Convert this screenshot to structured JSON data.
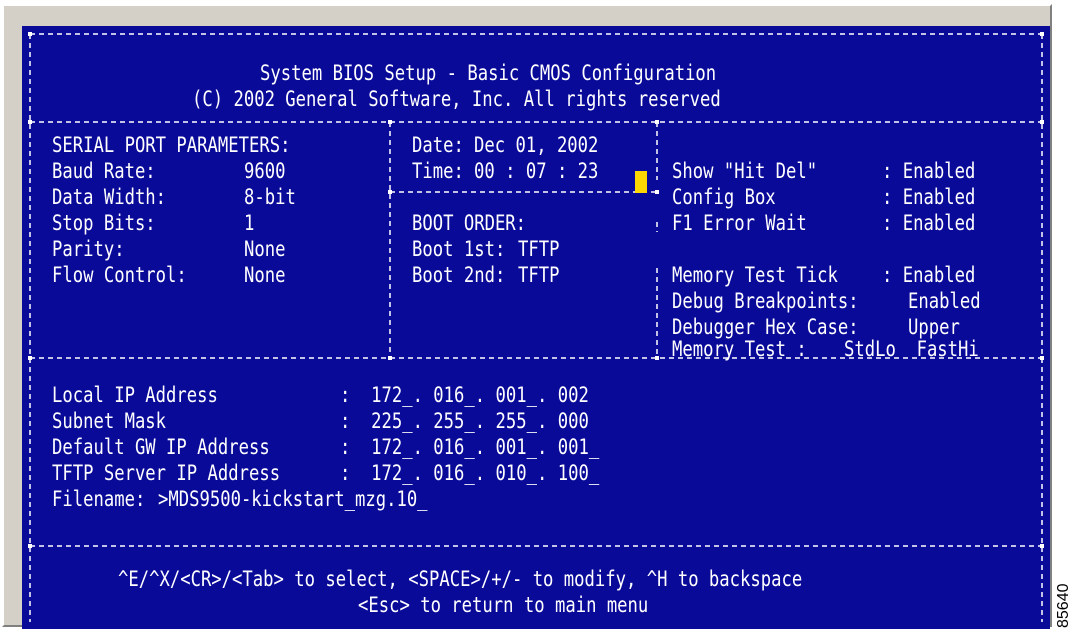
{
  "header": {
    "title": "System BIOS Setup - Basic CMOS Configuration",
    "copyright": "(C) 2002 General Software, Inc. All rights reserved"
  },
  "serial": {
    "heading": "SERIAL PORT PARAMETERS:",
    "baud_label": "Baud Rate:",
    "baud_value": "9600",
    "width_label": "Data Width:",
    "width_value": "8-bit",
    "stop_label": "Stop Bits:",
    "stop_value": "1",
    "parity_label": "Parity:",
    "parity_value": "None",
    "flow_label": "Flow Control:",
    "flow_value": "None"
  },
  "datetime": {
    "date_label": "Date:",
    "date_value": "Dec 01, 2002",
    "time_label": "Time:",
    "time_value": "00 : 07 : 23"
  },
  "boot": {
    "heading": "BOOT ORDER:",
    "first_label": "Boot 1st:",
    "first_value": "TFTP",
    "second_label": "Boot 2nd:",
    "second_value": "TFTP"
  },
  "options": {
    "hit_del_label": "Show \"Hit Del\"",
    "hit_del_value": ": Enabled",
    "config_box_label": "Config Box",
    "config_box_value": ": Enabled",
    "f1_label": "F1 Error Wait",
    "f1_value": ": Enabled",
    "mem_tick_label": "Memory Test Tick",
    "mem_tick_value": ": Enabled",
    "debug_bp_label": "Debug Breakpoints:",
    "debug_bp_value": "Enabled",
    "hex_case_label": "Debugger Hex Case:",
    "hex_case_value": "Upper",
    "mem_test_label": "Memory Test :",
    "mem_test_value": "StdLo  FastHi"
  },
  "network": {
    "local_ip_label": "Local IP Address",
    "local_ip_value": ":  172_. 016_. 001_. 002",
    "subnet_label": "Subnet Mask",
    "subnet_value": ":  225_. 255_. 255_. 000",
    "gateway_label": "Default GW IP Address",
    "gateway_value": ":  172_. 016_. 001_. 001_",
    "tftp_label": "TFTP Server IP Address",
    "tftp_value": ":  172_. 016_. 010_. 100_",
    "filename_label": "Filename:",
    "filename_value": ">MDS9500-kickstart_mzg.10_"
  },
  "footer": {
    "help_line": "^E/^X/<CR>/<Tab> to select, <SPACE>/+/- to modify, ^H to backspace",
    "esc_line": "<Esc> to return to main menu"
  },
  "figure_id": "85640",
  "colors": {
    "background": "#0a0a99",
    "text": "#ffffff",
    "cursor": "#ffd700"
  }
}
